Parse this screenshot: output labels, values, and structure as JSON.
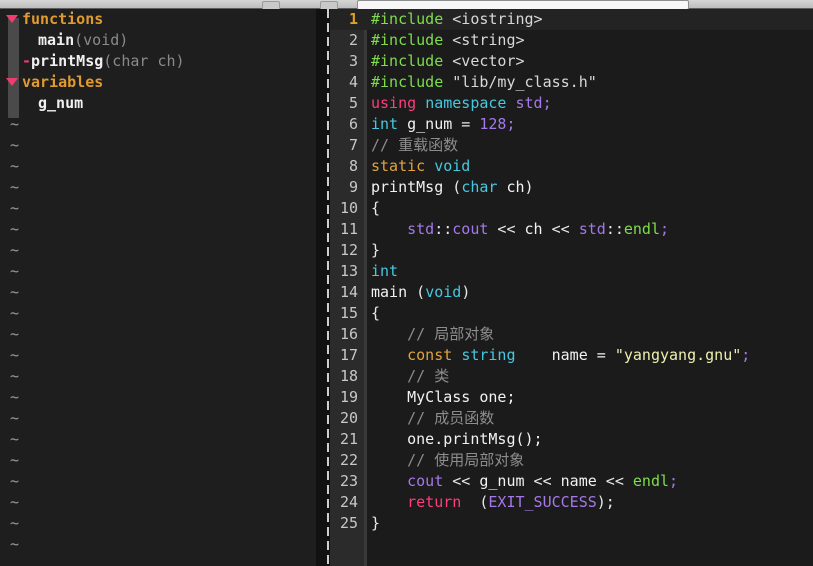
{
  "window": {
    "chrome_buttons": [
      "",
      ""
    ],
    "search_field_value": ""
  },
  "outline": {
    "groups": [
      {
        "label": "functions",
        "icon": "triangle-down-icon",
        "items": [
          {
            "prefix": "",
            "name": "main",
            "args": "(void)",
            "indent": "wide"
          },
          {
            "prefix": "-",
            "name": "printMsg",
            "args": "(char ch)",
            "indent": "narrow"
          }
        ]
      },
      {
        "label": "variables",
        "icon": "triangle-down-icon",
        "items": [
          {
            "prefix": "",
            "name": "g_num",
            "args": "",
            "indent": "wide"
          }
        ]
      }
    ],
    "empty_line_marker": "~",
    "empty_line_count": 21
  },
  "editor": {
    "lines": [
      {
        "n": "1",
        "current": true,
        "tokens": [
          {
            "t": "#include",
            "c": "k-pre"
          },
          {
            "t": " ",
            "c": "k-op"
          },
          {
            "t": "<iostring>",
            "c": "k-hdr"
          }
        ]
      },
      {
        "n": "2",
        "current": false,
        "tokens": [
          {
            "t": "#include",
            "c": "k-pre"
          },
          {
            "t": " ",
            "c": "k-op"
          },
          {
            "t": "<string>",
            "c": "k-hdr"
          }
        ]
      },
      {
        "n": "3",
        "current": false,
        "tokens": [
          {
            "t": "#include",
            "c": "k-pre"
          },
          {
            "t": " ",
            "c": "k-op"
          },
          {
            "t": "<vector>",
            "c": "k-hdr"
          }
        ]
      },
      {
        "n": "4",
        "current": false,
        "tokens": [
          {
            "t": "#include",
            "c": "k-pre"
          },
          {
            "t": " ",
            "c": "k-op"
          },
          {
            "t": "\"lib/my_class.h\"",
            "c": "k-hdr"
          }
        ]
      },
      {
        "n": "5",
        "current": false,
        "tokens": [
          {
            "t": "using",
            "c": "k-kw"
          },
          {
            "t": " ",
            "c": "k-op"
          },
          {
            "t": "namespace",
            "c": "k-ns"
          },
          {
            "t": " ",
            "c": "k-op"
          },
          {
            "t": "std",
            "c": "k-std"
          },
          {
            "t": ";",
            "c": "k-pun"
          }
        ]
      },
      {
        "n": "6",
        "current": false,
        "tokens": [
          {
            "t": "int",
            "c": "k-ty"
          },
          {
            "t": " ",
            "c": "k-op"
          },
          {
            "t": "g_num",
            "c": "k-id"
          },
          {
            "t": " = ",
            "c": "k-op"
          },
          {
            "t": "128",
            "c": "k-num"
          },
          {
            "t": ";",
            "c": "k-pun"
          }
        ]
      },
      {
        "n": "7",
        "current": false,
        "tokens": [
          {
            "t": "// 重载函数",
            "c": "k-cmt"
          }
        ]
      },
      {
        "n": "8",
        "current": false,
        "tokens": [
          {
            "t": "static",
            "c": "k-mod"
          },
          {
            "t": " ",
            "c": "k-op"
          },
          {
            "t": "void",
            "c": "k-ty"
          }
        ]
      },
      {
        "n": "9",
        "current": false,
        "tokens": [
          {
            "t": "printMsg ",
            "c": "k-id"
          },
          {
            "t": "(",
            "c": "k-op"
          },
          {
            "t": "char",
            "c": "k-ty"
          },
          {
            "t": " ch)",
            "c": "k-id"
          }
        ]
      },
      {
        "n": "10",
        "current": false,
        "tokens": [
          {
            "t": "{",
            "c": "k-op"
          }
        ]
      },
      {
        "n": "11",
        "current": false,
        "tokens": [
          {
            "t": "    ",
            "c": "k-op"
          },
          {
            "t": "std",
            "c": "k-std"
          },
          {
            "t": "::",
            "c": "k-op"
          },
          {
            "t": "cout",
            "c": "k-std"
          },
          {
            "t": " << ",
            "c": "k-op"
          },
          {
            "t": "ch",
            "c": "k-id"
          },
          {
            "t": " << ",
            "c": "k-op"
          },
          {
            "t": "std",
            "c": "k-std"
          },
          {
            "t": "::",
            "c": "k-op"
          },
          {
            "t": "endl",
            "c": "k-grn"
          },
          {
            "t": ";",
            "c": "k-pun"
          }
        ]
      },
      {
        "n": "12",
        "current": false,
        "tokens": [
          {
            "t": "}",
            "c": "k-op"
          }
        ]
      },
      {
        "n": "13",
        "current": false,
        "tokens": [
          {
            "t": "int",
            "c": "k-ty"
          }
        ]
      },
      {
        "n": "14",
        "current": false,
        "tokens": [
          {
            "t": "main ",
            "c": "k-id"
          },
          {
            "t": "(",
            "c": "k-op"
          },
          {
            "t": "void",
            "c": "k-ty"
          },
          {
            "t": ")",
            "c": "k-op"
          }
        ]
      },
      {
        "n": "15",
        "current": false,
        "tokens": [
          {
            "t": "{",
            "c": "k-op"
          }
        ]
      },
      {
        "n": "16",
        "current": false,
        "tokens": [
          {
            "t": "    ",
            "c": "k-op"
          },
          {
            "t": "// 局部对象",
            "c": "k-cmt"
          }
        ]
      },
      {
        "n": "17",
        "current": false,
        "tokens": [
          {
            "t": "    ",
            "c": "k-op"
          },
          {
            "t": "const",
            "c": "k-mod"
          },
          {
            "t": " ",
            "c": "k-op"
          },
          {
            "t": "string",
            "c": "k-ty"
          },
          {
            "t": "    name = ",
            "c": "k-id"
          },
          {
            "t": "\"yangyang.gnu\"",
            "c": "k-str"
          },
          {
            "t": ";",
            "c": "k-pun"
          }
        ]
      },
      {
        "n": "18",
        "current": false,
        "tokens": [
          {
            "t": "    ",
            "c": "k-op"
          },
          {
            "t": "// 类",
            "c": "k-cmt"
          }
        ]
      },
      {
        "n": "19",
        "current": false,
        "tokens": [
          {
            "t": "    ",
            "c": "k-op"
          },
          {
            "t": "MyClass one;",
            "c": "k-id"
          }
        ]
      },
      {
        "n": "20",
        "current": false,
        "tokens": [
          {
            "t": "    ",
            "c": "k-op"
          },
          {
            "t": "// 成员函数",
            "c": "k-cmt"
          }
        ]
      },
      {
        "n": "21",
        "current": false,
        "tokens": [
          {
            "t": "    ",
            "c": "k-op"
          },
          {
            "t": "one.printMsg();",
            "c": "k-id"
          }
        ]
      },
      {
        "n": "22",
        "current": false,
        "tokens": [
          {
            "t": "    ",
            "c": "k-op"
          },
          {
            "t": "// 使用局部对象",
            "c": "k-cmt"
          }
        ]
      },
      {
        "n": "23",
        "current": false,
        "tokens": [
          {
            "t": "    ",
            "c": "k-op"
          },
          {
            "t": "cout",
            "c": "k-std"
          },
          {
            "t": " << ",
            "c": "k-op"
          },
          {
            "t": "g_num",
            "c": "k-id"
          },
          {
            "t": " << ",
            "c": "k-op"
          },
          {
            "t": "name",
            "c": "k-id"
          },
          {
            "t": " << ",
            "c": "k-op"
          },
          {
            "t": "endl",
            "c": "k-grn"
          },
          {
            "t": ";",
            "c": "k-pun"
          }
        ]
      },
      {
        "n": "24",
        "current": false,
        "tokens": [
          {
            "t": "    ",
            "c": "k-op"
          },
          {
            "t": "return",
            "c": "k-kw"
          },
          {
            "t": "  (",
            "c": "k-op"
          },
          {
            "t": "EXIT_SUCCESS",
            "c": "k-std"
          },
          {
            "t": ");",
            "c": "k-op"
          }
        ]
      },
      {
        "n": "25",
        "current": false,
        "tokens": [
          {
            "t": "}",
            "c": "k-op"
          }
        ]
      }
    ]
  }
}
